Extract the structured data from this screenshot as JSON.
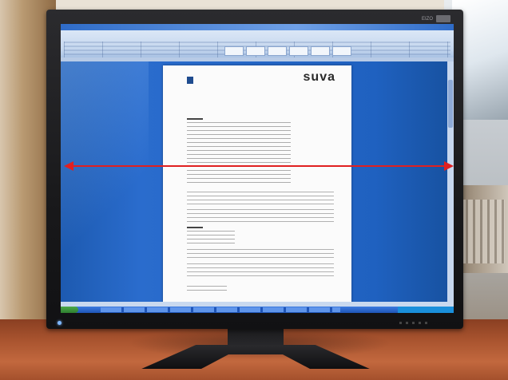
{
  "monitor": {
    "brand": "EIZO"
  },
  "document": {
    "logo_text": "suva"
  },
  "colors": {
    "arrow": "#e02020",
    "screen_bg": "#1f5fb8",
    "desk": "#a9542f",
    "bezel": "#1a1a1c"
  },
  "icons": {
    "power_led": "power-led-icon",
    "start_button": "windows-start-icon"
  }
}
